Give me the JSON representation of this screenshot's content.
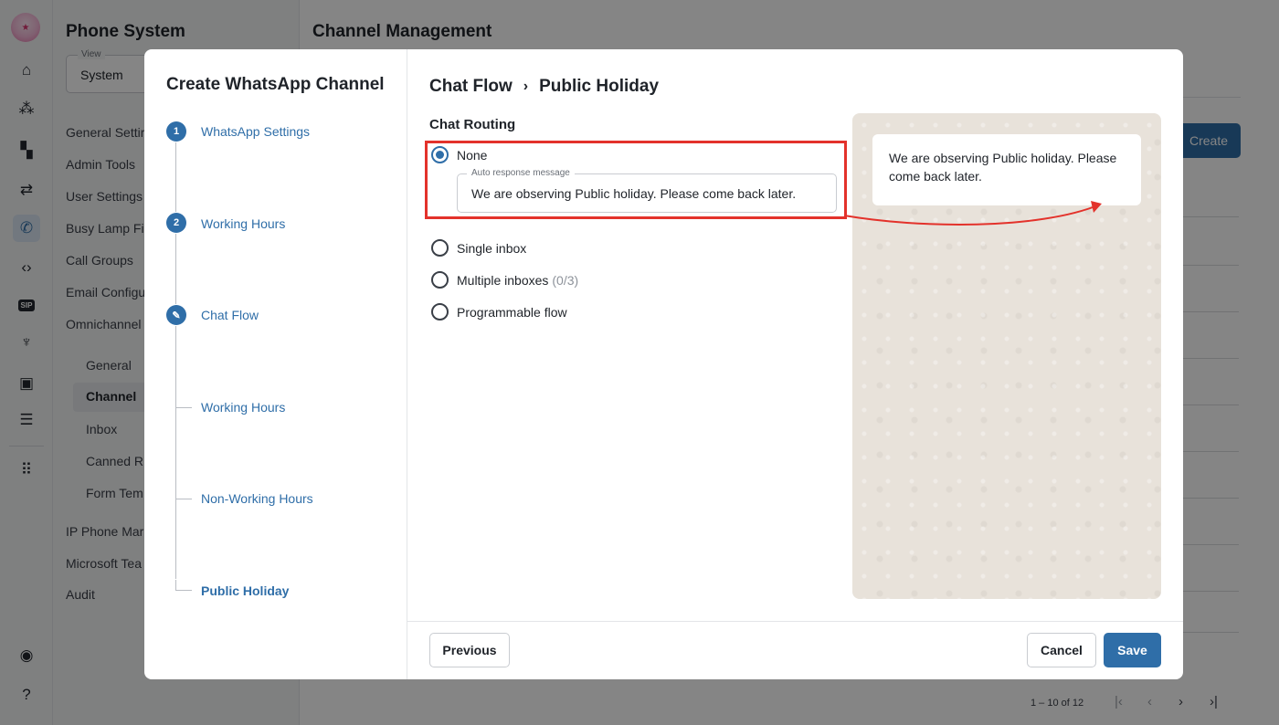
{
  "app": {
    "title": "Phone System",
    "page_title": "Channel Management",
    "view": {
      "label": "View",
      "value": "System"
    },
    "nav_items": [
      "General Settir",
      "Admin Tools",
      "User Settings",
      "Busy Lamp Fi",
      "Call Groups",
      "Email Configu",
      "Omnichannel"
    ],
    "omni_items": [
      "General",
      "Channel",
      "Inbox",
      "Canned R",
      "Form Tem"
    ],
    "nav_items_after": [
      "IP Phone Mar",
      "Microsoft Tea",
      "Audit"
    ],
    "create_label": "Create",
    "pagination": {
      "range": "1 – 10 of 12"
    },
    "rail_icons": [
      "home-icon",
      "hierarchy-icon",
      "dashboard-icon",
      "transfer-icon",
      "phone-icon",
      "code-icon",
      "sip-icon",
      "antenna-icon",
      "contacts-icon",
      "server-icon",
      "apps-icon",
      "broadcast-icon",
      "help-icon"
    ]
  },
  "modal": {
    "title": "Create WhatsApp Channel",
    "steps": [
      {
        "number": "1",
        "label": "WhatsApp Settings"
      },
      {
        "number": "2",
        "label": "Working Hours"
      },
      {
        "number": "",
        "label": "Chat Flow"
      }
    ],
    "substeps": [
      {
        "label": "Working Hours"
      },
      {
        "label": "Non-Working Hours"
      },
      {
        "label": "Public Holiday"
      }
    ],
    "breadcrumb": {
      "parent": "Chat Flow",
      "separator": "›",
      "current": "Public Holiday"
    },
    "section_title": "Chat Routing",
    "options": {
      "none": "None",
      "single": "Single inbox",
      "multiple": "Multiple inboxes",
      "multiple_count": "(0/3)",
      "programmable": "Programmable flow"
    },
    "selected_option": "none",
    "auto_response": {
      "label": "Auto response message",
      "value": "We are observing Public holiday. Please come back later."
    },
    "preview_message": "We are observing Public holiday. Please come back later.",
    "buttons": {
      "previous": "Previous",
      "cancel": "Cancel",
      "save": "Save"
    }
  },
  "colors": {
    "accent": "#2f6ea8",
    "highlight": "#e3322b",
    "preview_bg": "#e8e2da"
  }
}
